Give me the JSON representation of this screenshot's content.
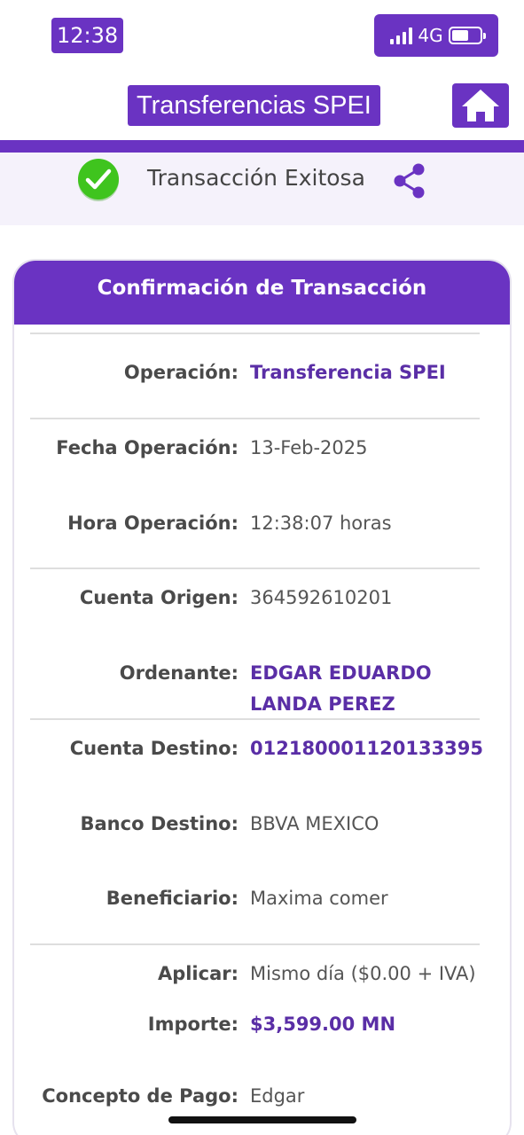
{
  "status_bar": {
    "time": "12:38",
    "network": "4G"
  },
  "header": {
    "title": "Transferencias SPEI",
    "home_icon": "home-icon"
  },
  "banner": {
    "success_text": "Transacción Exitosa",
    "success_icon": "check-circle-icon",
    "share_icon": "share-icon"
  },
  "card": {
    "title": "Confirmación de Transacción",
    "rows": [
      {
        "label": "Operación:",
        "value": "Transferencia SPEI"
      },
      {
        "label": "Fecha Operación:",
        "value": "13-Feb-2025"
      },
      {
        "label": "Hora Operación:",
        "value": "12:38:07 horas"
      },
      {
        "label": "Cuenta Origen:",
        "value": "364592610201"
      },
      {
        "label": "Ordenante:",
        "value_line1": "EDGAR EDUARDO",
        "value_line2": "LANDA PEREZ"
      },
      {
        "label": "Cuenta Destino:",
        "value": "012180001120133395"
      },
      {
        "label": "Banco Destino:",
        "value": "BBVA MEXICO"
      },
      {
        "label": "Beneficiario:",
        "value": "Maxima comer"
      },
      {
        "label": "Aplicar:",
        "value": "Mismo día ($0.00 + IVA)"
      },
      {
        "label": "Importe:",
        "value": "$3,599.00 MN"
      },
      {
        "label": "Concepto de Pago:",
        "value": "Edgar"
      }
    ]
  },
  "colors": {
    "brand": "#6a33c2",
    "accent_text": "#5a2ea6",
    "success": "#3fc41e"
  }
}
